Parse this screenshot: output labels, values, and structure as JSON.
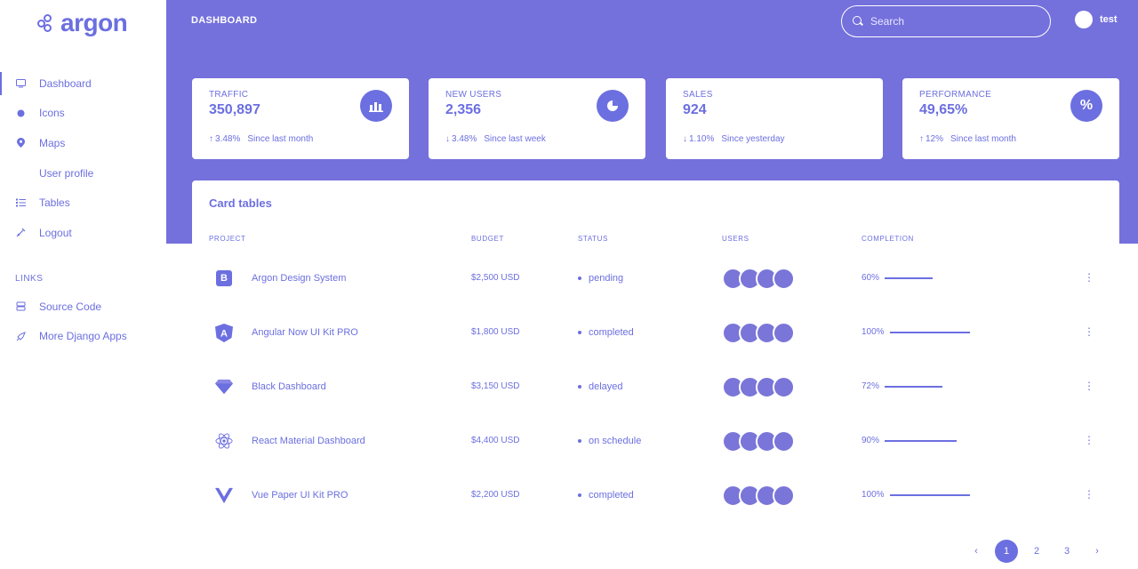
{
  "brand": {
    "name": "argon"
  },
  "sidebar": {
    "items": [
      {
        "label": "Dashboard",
        "icon": "tv-icon",
        "active": true
      },
      {
        "label": "Icons",
        "icon": "planet-icon"
      },
      {
        "label": "Maps",
        "icon": "pin-icon"
      },
      {
        "label": "User profile",
        "icon": ""
      },
      {
        "label": "Tables",
        "icon": "list-icon"
      },
      {
        "label": "Logout",
        "icon": "key-icon"
      }
    ],
    "links_title": "LINKS",
    "links": [
      {
        "label": "Source Code",
        "icon": "spaceship-icon"
      },
      {
        "label": "More Django Apps",
        "icon": "rocket-icon"
      }
    ]
  },
  "header": {
    "title": "DASHBOARD",
    "search_placeholder": "Search",
    "user_name": "test"
  },
  "stats": [
    {
      "title": "TRAFFIC",
      "value": "350,897",
      "change": "3.48%",
      "direction": "up",
      "period": "Since last month",
      "icon": "chart-bar-icon"
    },
    {
      "title": "NEW USERS",
      "value": "2,356",
      "change": "3.48%",
      "direction": "down",
      "period": "Since last week",
      "icon": "chart-pie-icon"
    },
    {
      "title": "SALES",
      "value": "924",
      "change": "1.10%",
      "direction": "down",
      "period": "Since yesterday",
      "icon": ""
    },
    {
      "title": "PERFORMANCE",
      "value": "49,65%",
      "change": "12%",
      "direction": "up",
      "period": "Since last month",
      "icon": "percent-icon"
    }
  ],
  "table": {
    "title": "Card tables",
    "columns": [
      "PROJECT",
      "BUDGET",
      "STATUS",
      "USERS",
      "COMPLETION"
    ],
    "rows": [
      {
        "icon": "bootstrap-icon",
        "project": "Argon Design System",
        "budget": "$2,500 USD",
        "status": "pending",
        "completion": "60%",
        "completion_value": 60
      },
      {
        "icon": "angular-icon",
        "project": "Angular Now UI Kit PRO",
        "budget": "$1,800 USD",
        "status": "completed",
        "completion": "100%",
        "completion_value": 100
      },
      {
        "icon": "sketch-icon",
        "project": "Black Dashboard",
        "budget": "$3,150 USD",
        "status": "delayed",
        "completion": "72%",
        "completion_value": 72
      },
      {
        "icon": "react-icon",
        "project": "React Material Dashboard",
        "budget": "$4,400 USD",
        "status": "on schedule",
        "completion": "90%",
        "completion_value": 90
      },
      {
        "icon": "vue-icon",
        "project": "Vue Paper UI Kit PRO",
        "budget": "$2,200 USD",
        "status": "completed",
        "completion": "100%",
        "completion_value": 100
      }
    ]
  },
  "pagination": {
    "prev": "‹",
    "pages": [
      "1",
      "2",
      "3"
    ],
    "current": "1",
    "next": "›"
  },
  "colors": {
    "primary": "#6c6fe0",
    "header_bg": "#7470dc",
    "white": "#ffffff"
  }
}
